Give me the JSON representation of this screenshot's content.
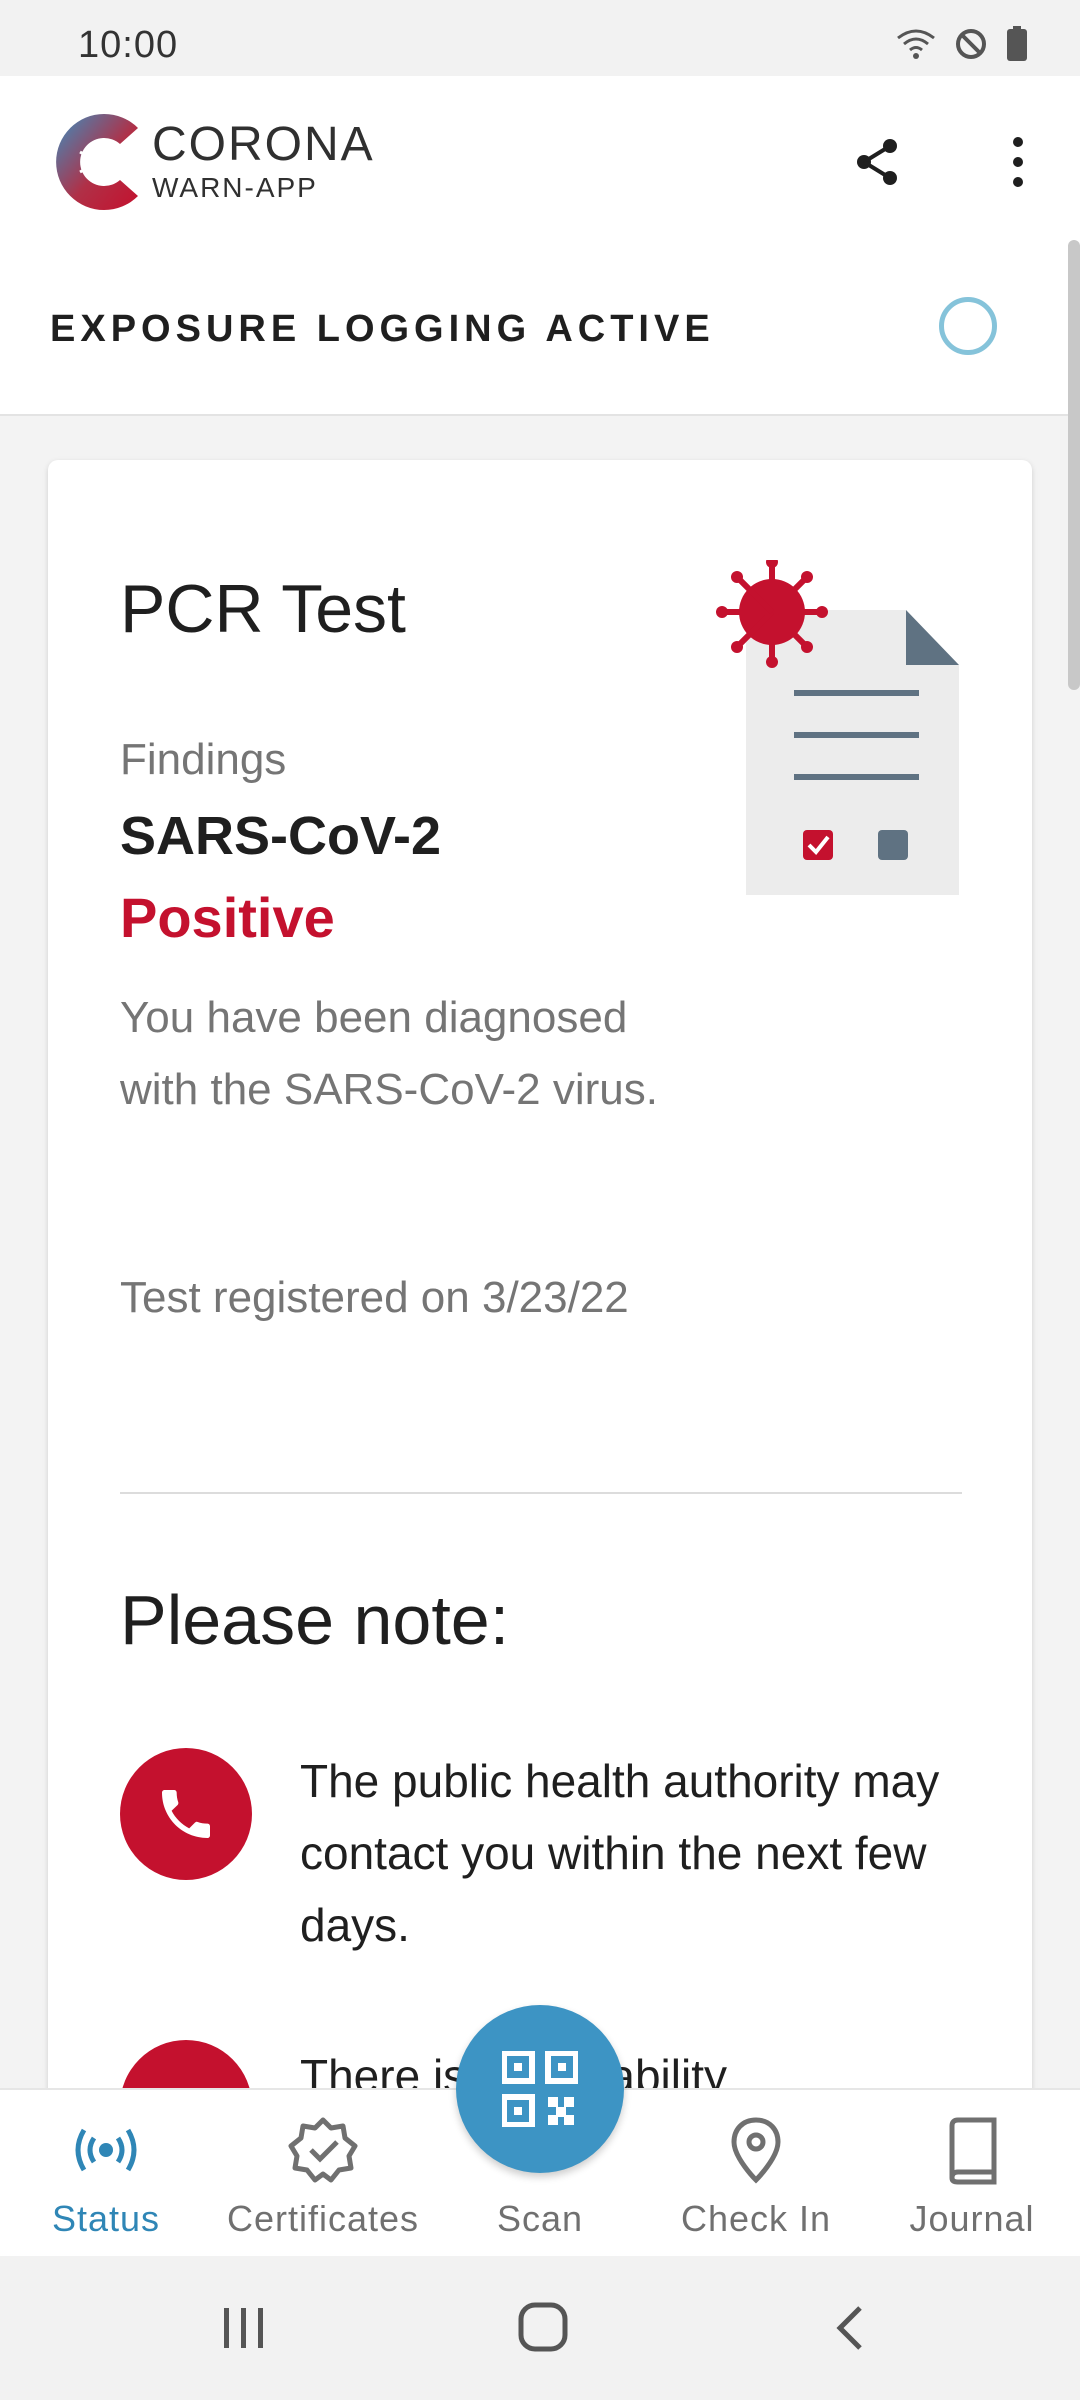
{
  "status_bar": {
    "time": "10:00"
  },
  "app": {
    "brand_line1": "CORONA",
    "brand_line2": "WARN-APP"
  },
  "exposure": {
    "label": "EXPOSURE LOGGING ACTIVE"
  },
  "test_card": {
    "title": "PCR Test",
    "findings_label": "Findings",
    "findings_value": "SARS-CoV-2",
    "result": "Positive",
    "description": "You have been diagnosed with the SARS-CoV-2 virus.",
    "registered": "Test registered on 3/23/22",
    "note_title": "Please note:",
    "notes": [
      {
        "icon": "phone-icon",
        "text": "The public health authority may contact you within the next few days."
      },
      {
        "icon": "home-icon",
        "text": "There is a probability"
      }
    ]
  },
  "bottom_nav": {
    "items": [
      {
        "label": "Status",
        "icon": "status-icon",
        "active": true
      },
      {
        "label": "Certificates",
        "icon": "certificate-icon"
      },
      {
        "label": "Scan",
        "icon": "qr-code-icon"
      },
      {
        "label": "Check In",
        "icon": "location-pin-icon"
      },
      {
        "label": "Journal",
        "icon": "journal-icon"
      }
    ]
  },
  "colors": {
    "accent": "#3d94c4",
    "positive": "#c4112e",
    "active_nav": "#2f86b6"
  }
}
